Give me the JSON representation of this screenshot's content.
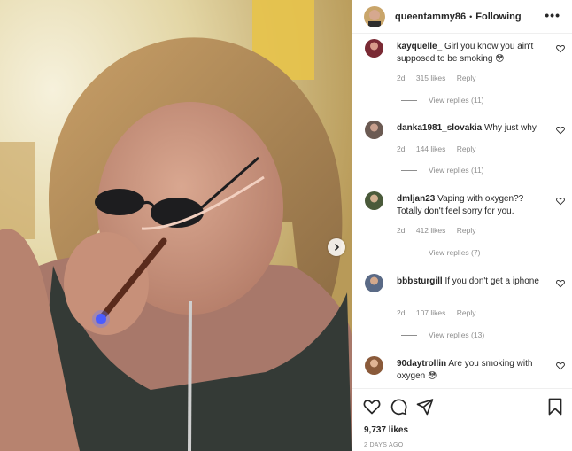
{
  "header": {
    "username": "queentammy86",
    "separator": "•",
    "following_label": "Following",
    "more_label": "•••"
  },
  "comments": [
    {
      "username": "kayquelle_",
      "text": "Girl you know you ain't supposed to be smoking 😳",
      "age": "2d",
      "likes": "315 likes",
      "reply_label": "Reply",
      "view_replies": "View replies (11)",
      "avatar_color": "#7a2a34"
    },
    {
      "username": "danka1981_slovakia",
      "text": "Why just why",
      "age": "2d",
      "likes": "144 likes",
      "reply_label": "Reply",
      "view_replies": "View replies (11)",
      "avatar_color": "#6b5a52"
    },
    {
      "username": "dmljan23",
      "text": "Vaping with oxygen?? Totally don't feel sorry for you.",
      "age": "2d",
      "likes": "412 likes",
      "reply_label": "Reply",
      "view_replies": "View replies (7)",
      "avatar_color": "#4a5a3a"
    },
    {
      "username": "bbbsturgill",
      "text": "If you don't get a iphone",
      "age": "2d",
      "likes": "107 likes",
      "reply_label": "Reply",
      "view_replies": "View replies (13)",
      "avatar_color": "#5a6a86"
    },
    {
      "username": "90daytrollin",
      "text": "Are you smoking with oxygen 😳",
      "avatar_color": "#8a5a3a"
    }
  ],
  "footer": {
    "likes": "9,737 likes",
    "date": "2 DAYS AGO"
  },
  "icons": {
    "heart": "heart-icon",
    "comment": "comment-icon",
    "share": "paper-plane-icon",
    "save": "bookmark-icon",
    "next": "chevron-right-icon"
  }
}
